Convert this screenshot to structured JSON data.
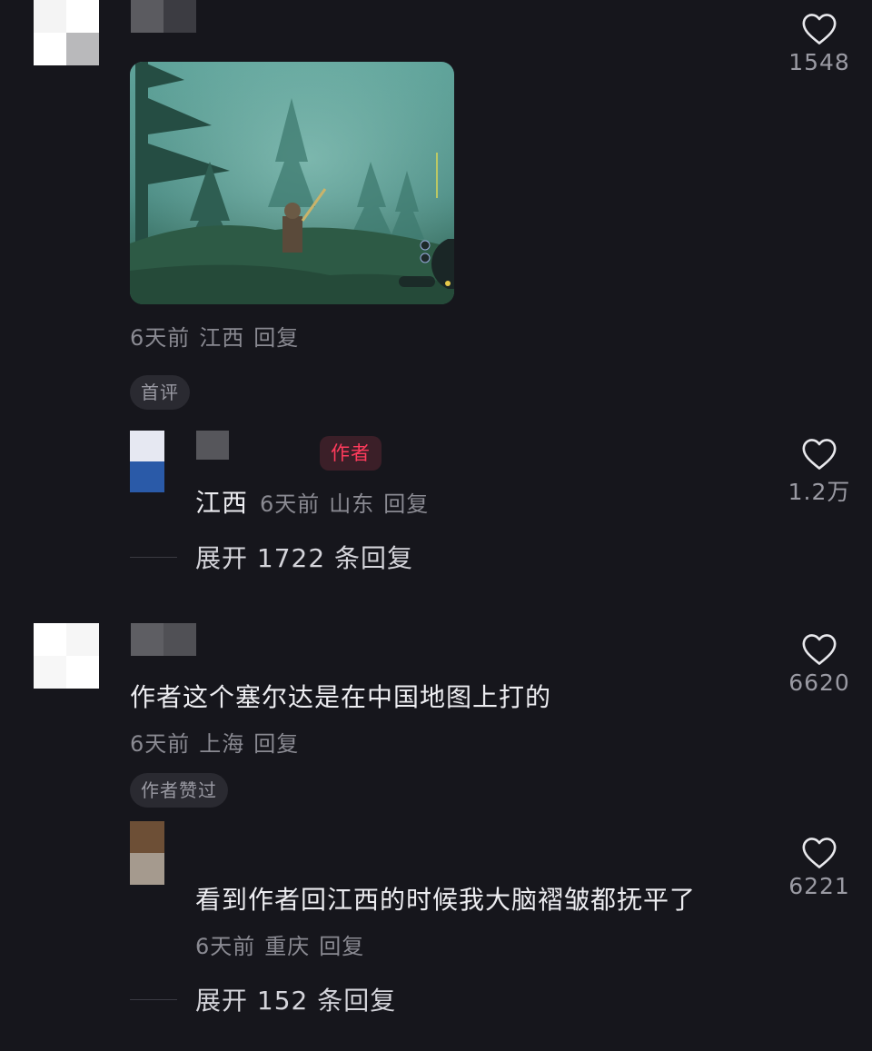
{
  "comments": [
    {
      "like_count": "1548",
      "image_alt": "game screenshot",
      "meta": {
        "time": "6天前",
        "location": "江西",
        "reply": "回复"
      },
      "tag": "首评"
    },
    {
      "author_badge": "作者",
      "text": "江西",
      "meta": {
        "time": "6天前",
        "location": "山东",
        "reply": "回复"
      },
      "like_count": "1.2万",
      "expand": "展开 1722 条回复"
    },
    {
      "text": "作者这个塞尔达是在中国地图上打的",
      "meta": {
        "time": "6天前",
        "location": "上海",
        "reply": "回复"
      },
      "like_count": "6620",
      "tag": "作者赞过"
    },
    {
      "text": "看到作者回江西的时候我大脑褶皱都抚平了",
      "meta": {
        "time": "6天前",
        "location": "重庆",
        "reply": "回复"
      },
      "like_count": "6221",
      "expand": "展开 152 条回复"
    }
  ],
  "colors": {
    "background": "#16161c",
    "accent": "#ff3b5c",
    "muted": "#8a8a92"
  },
  "icons": {
    "like": "heart-outline-icon"
  }
}
